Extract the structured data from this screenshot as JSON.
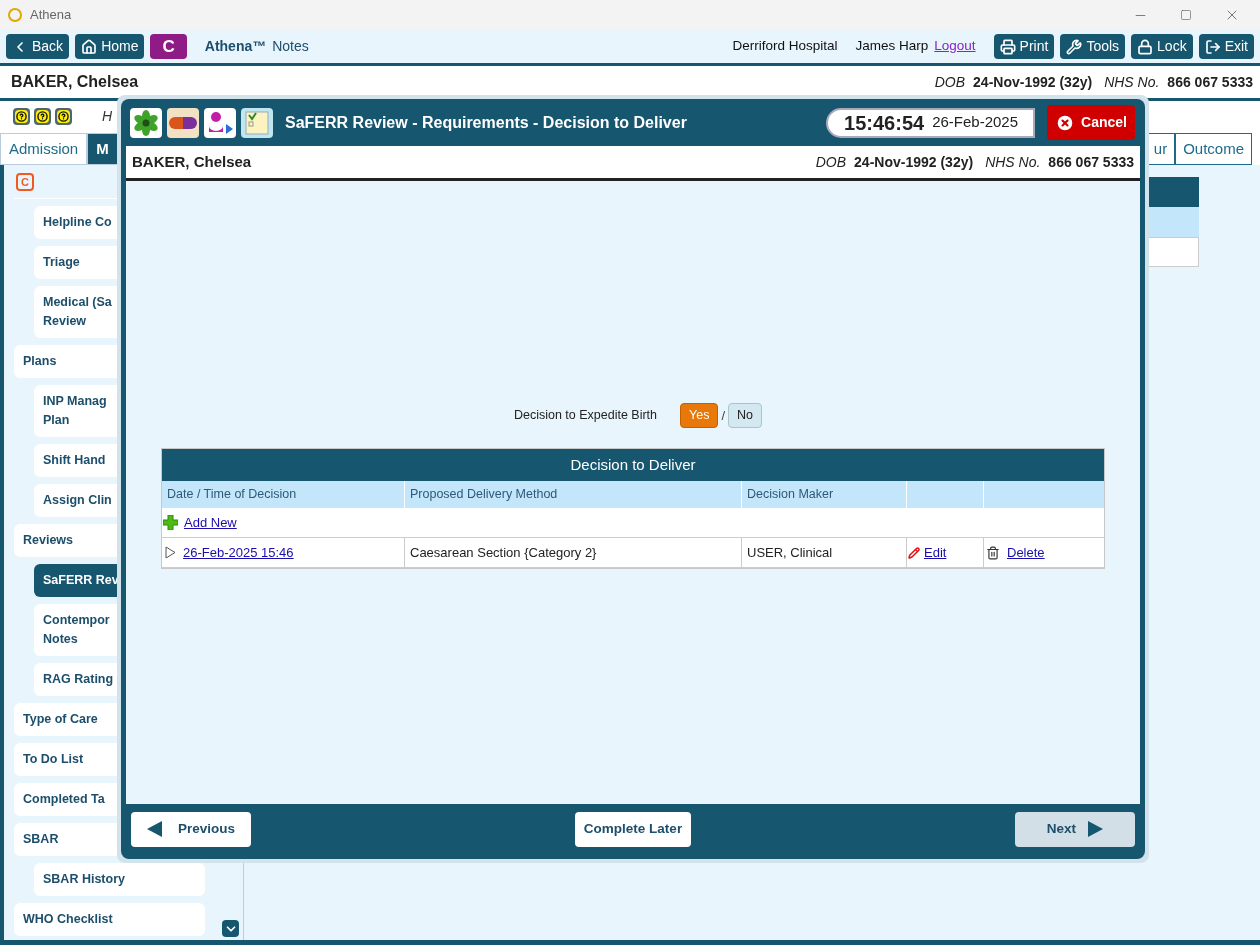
{
  "window": {
    "title": "Athena"
  },
  "toolbar": {
    "left_buttons": [
      {
        "kind": "back",
        "label": "Back"
      },
      {
        "kind": "home",
        "label": "Home"
      },
      {
        "kind": "letter",
        "label": "C"
      }
    ],
    "app_name": "Athena™",
    "app_subtitle": "Notes",
    "hospital": "Derriford Hospital",
    "user": "James Harp",
    "logout": "Logout",
    "right_buttons": [
      {
        "kind": "print",
        "label": "Print"
      },
      {
        "kind": "tools",
        "label": "Tools"
      },
      {
        "kind": "lock",
        "label": "Lock"
      },
      {
        "kind": "exit",
        "label": "Exit"
      }
    ]
  },
  "patient": {
    "name": "BAKER, Chelsea",
    "dob_label": "DOB",
    "dob": "24-Nov-1992 (32y)",
    "nhs_label": "NHS No.",
    "nhs": "866 067 5333"
  },
  "help_text": "H",
  "tabs_left": [
    {
      "label": "Admission",
      "selected": false
    },
    {
      "label": "M",
      "selected": true
    }
  ],
  "tabs_right": [
    {
      "label": "ur",
      "selected": false
    },
    {
      "label": "Outcome",
      "selected": false
    }
  ],
  "sidebar": {
    "badge": "C",
    "items": [
      {
        "children": [
          {
            "label": "Helpline Co",
            "selected": false
          },
          {
            "label": "Triage",
            "selected": false
          },
          {
            "label": "Medical (Sa\nReview",
            "selected": false
          }
        ]
      },
      {
        "label": "Plans",
        "selected": false,
        "children": [
          {
            "label": "INP Manag\nPlan",
            "selected": false
          },
          {
            "label": "Shift Hand",
            "selected": false
          },
          {
            "label": "Assign Clin",
            "selected": false
          }
        ]
      },
      {
        "label": "Reviews",
        "selected": false,
        "children": [
          {
            "label": "SaFERR Rev",
            "selected": true
          },
          {
            "label": "Contempor\nNotes",
            "selected": false
          },
          {
            "label": "RAG Rating",
            "selected": false
          }
        ]
      },
      {
        "label": "Type of Care",
        "selected": false
      },
      {
        "label": "To Do List",
        "selected": false
      },
      {
        "label": "Completed Ta",
        "selected": false
      },
      {
        "label": "SBAR",
        "selected": false,
        "children": [
          {
            "label": "SBAR History",
            "selected": false
          }
        ]
      },
      {
        "label": "WHO Checklist",
        "selected": false
      }
    ]
  },
  "dialog": {
    "title": "SaFERR Review - Requirements - Decision to Deliver",
    "time": "15:46:54",
    "date": "26-Feb-2025",
    "cancel": "Cancel",
    "patient": {
      "name": "BAKER, Chelsea",
      "dob_label": "DOB",
      "dob": "24-Nov-1992 (32y)",
      "nhs_label": "NHS No.",
      "nhs": "866 067 5333"
    },
    "question": {
      "label": "Decision to Expedite Birth",
      "separator": "/",
      "options": [
        {
          "label": "Yes",
          "selected": true
        },
        {
          "label": "No",
          "selected": false
        }
      ]
    },
    "table": {
      "title": "Decision to Deliver",
      "columns": [
        "Date / Time of Decision",
        "Proposed Delivery Method",
        "Decision Maker"
      ],
      "add_new": "Add New",
      "rows": [
        {
          "date": "26-Feb-2025 15:46",
          "method": "Caesarean Section {Category 2}",
          "maker": "USER, Clinical",
          "edit": "Edit",
          "delete": "Delete",
          "expanded": false
        }
      ]
    },
    "footer": {
      "previous": "Previous",
      "complete_later": "Complete Later",
      "next": {
        "label": "Next",
        "disabled": true
      }
    }
  }
}
